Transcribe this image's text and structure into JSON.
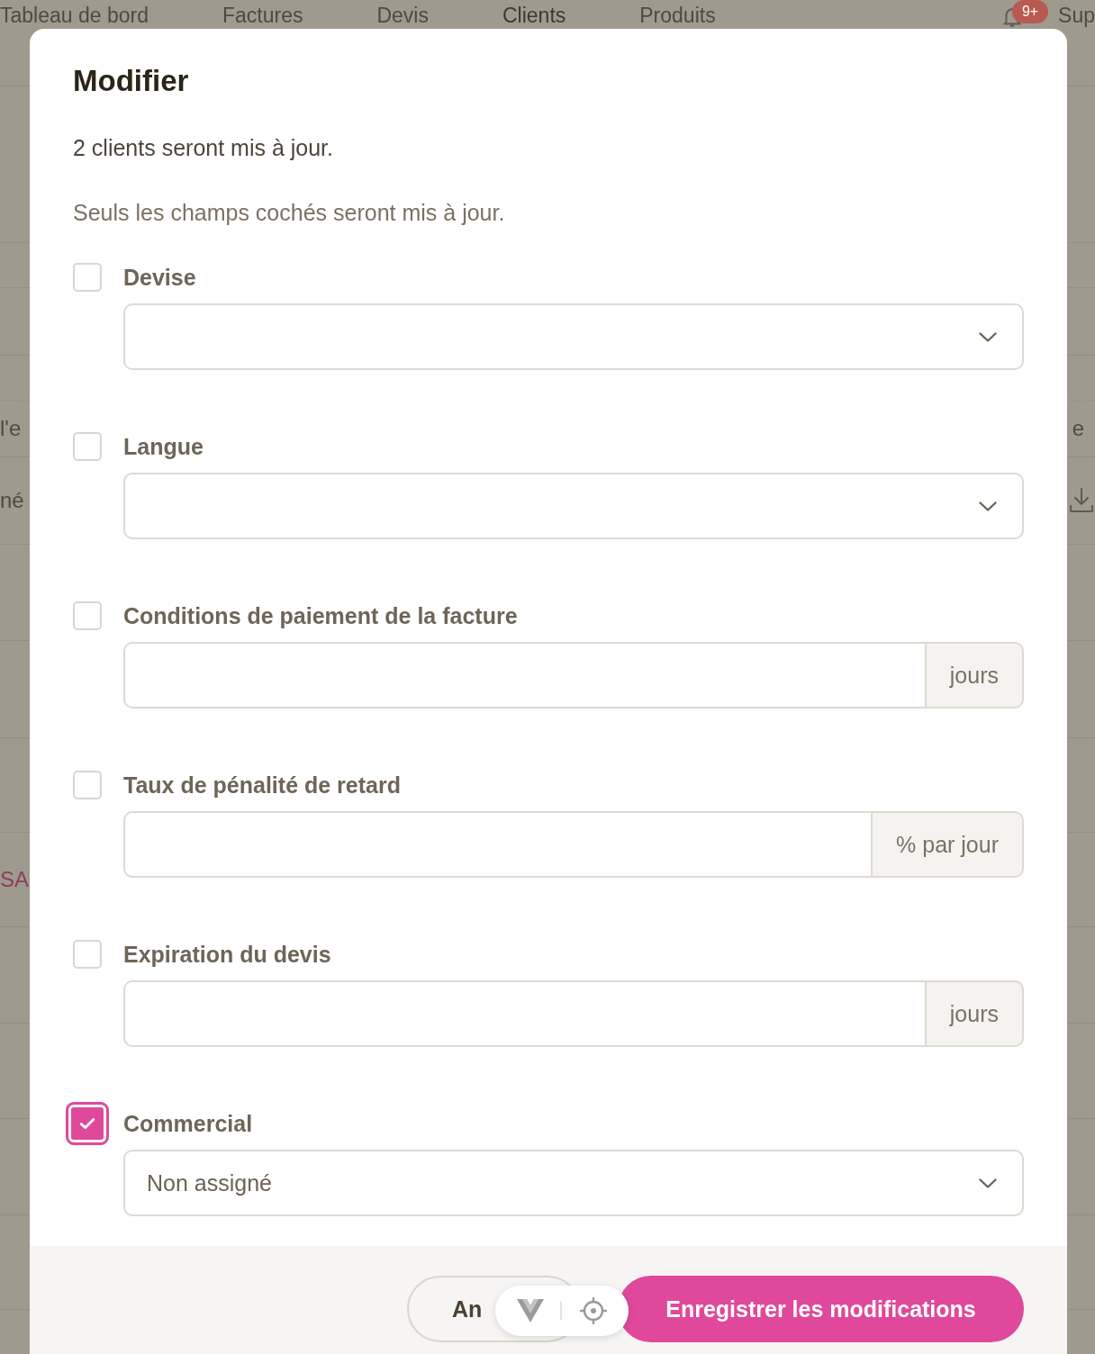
{
  "page_behind": {
    "nav": [
      {
        "label": "Tableau de bord",
        "selected": false
      },
      {
        "label": "Factures",
        "selected": false
      },
      {
        "label": "Devis",
        "selected": false
      },
      {
        "label": "Clients",
        "selected": true
      },
      {
        "label": "Produits",
        "selected": false
      }
    ],
    "notification_badge": "9+",
    "nav_cut": "Sup",
    "rows": [
      {
        "kind": "text",
        "left": "l'e",
        "right": "e"
      },
      {
        "kind": "download",
        "left": "né"
      },
      {
        "kind": "accent",
        "left": "SA"
      }
    ]
  },
  "dialog": {
    "title": "Modifier",
    "summary": "2 clients seront mis à jour.",
    "hint": "Seuls les champs cochés seront mis à jour.",
    "fields": [
      {
        "label": "Devise",
        "kind": "select",
        "checked": false,
        "focused": false
      },
      {
        "label": "Langue",
        "kind": "select",
        "checked": false,
        "focused": false
      },
      {
        "label": "Conditions de paiement de la facture",
        "kind": "number",
        "unit": "jours",
        "checked": false,
        "focused": false
      },
      {
        "label": "Taux de pénalité de retard",
        "kind": "number",
        "unit": "% par jour",
        "checked": false,
        "focused": false
      },
      {
        "label": "Expiration du devis",
        "kind": "number",
        "unit": "jours",
        "checked": false,
        "focused": false
      },
      {
        "label": "Commercial",
        "kind": "select",
        "value": "Non assigné",
        "checked": true,
        "focused": true
      }
    ],
    "buttons": [
      {
        "kind": "secondary",
        "label": "An"
      },
      {
        "kind": "primary",
        "label": "Enregistrer les modifications"
      }
    ]
  }
}
